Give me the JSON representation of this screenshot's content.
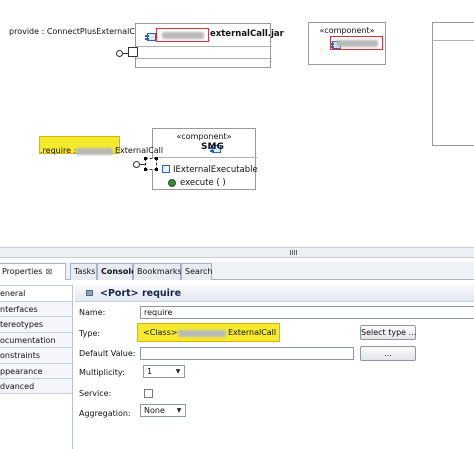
{
  "diagram": {
    "provide_label": "provide : ConnectPlusExternalCall",
    "jar_component": {
      "name_suffix": "externalCall.jar"
    },
    "top_component": {
      "stereotype": "«component»"
    },
    "smg_component": {
      "stereotype": "«component»",
      "name": "SMG",
      "interface_name": "IExternalExecutable",
      "operation": "execute ( )"
    },
    "require_label": {
      "prefix": ".require : ",
      "suffix": "ExternalCall"
    }
  },
  "views": {
    "tabs": [
      {
        "label": "Properties",
        "close": "⊠"
      },
      {
        "label": "Tasks"
      },
      {
        "label": "Console"
      },
      {
        "label": "Bookmarks"
      },
      {
        "label": "Search"
      }
    ]
  },
  "properties": {
    "sections": [
      "eneral",
      "nterfaces",
      "tereotypes",
      "ocumentation",
      "onstraints",
      "ppearance",
      "dvanced"
    ],
    "selected_section": "eneral",
    "title": "<Port> require",
    "fields": {
      "name_label": "Name:",
      "name_value": "require",
      "type_label": "Type:",
      "type_prefix": "<Class> ",
      "type_suffix": "ExternalCall",
      "select_type_button": "Select type ...",
      "default_value_label": "Default Value:",
      "default_value_value": "",
      "ellipsis_button": "...",
      "multiplicity_label": "Multiplicity:",
      "multiplicity_value": "1",
      "service_label": "Service:",
      "service_checked": false,
      "aggregation_label": "Aggregation:",
      "aggregation_value": "None"
    }
  },
  "colors": {
    "highlight": "#f6ea2c",
    "annotation_box": "#e0303c",
    "component_icon": "#2a64b4"
  }
}
